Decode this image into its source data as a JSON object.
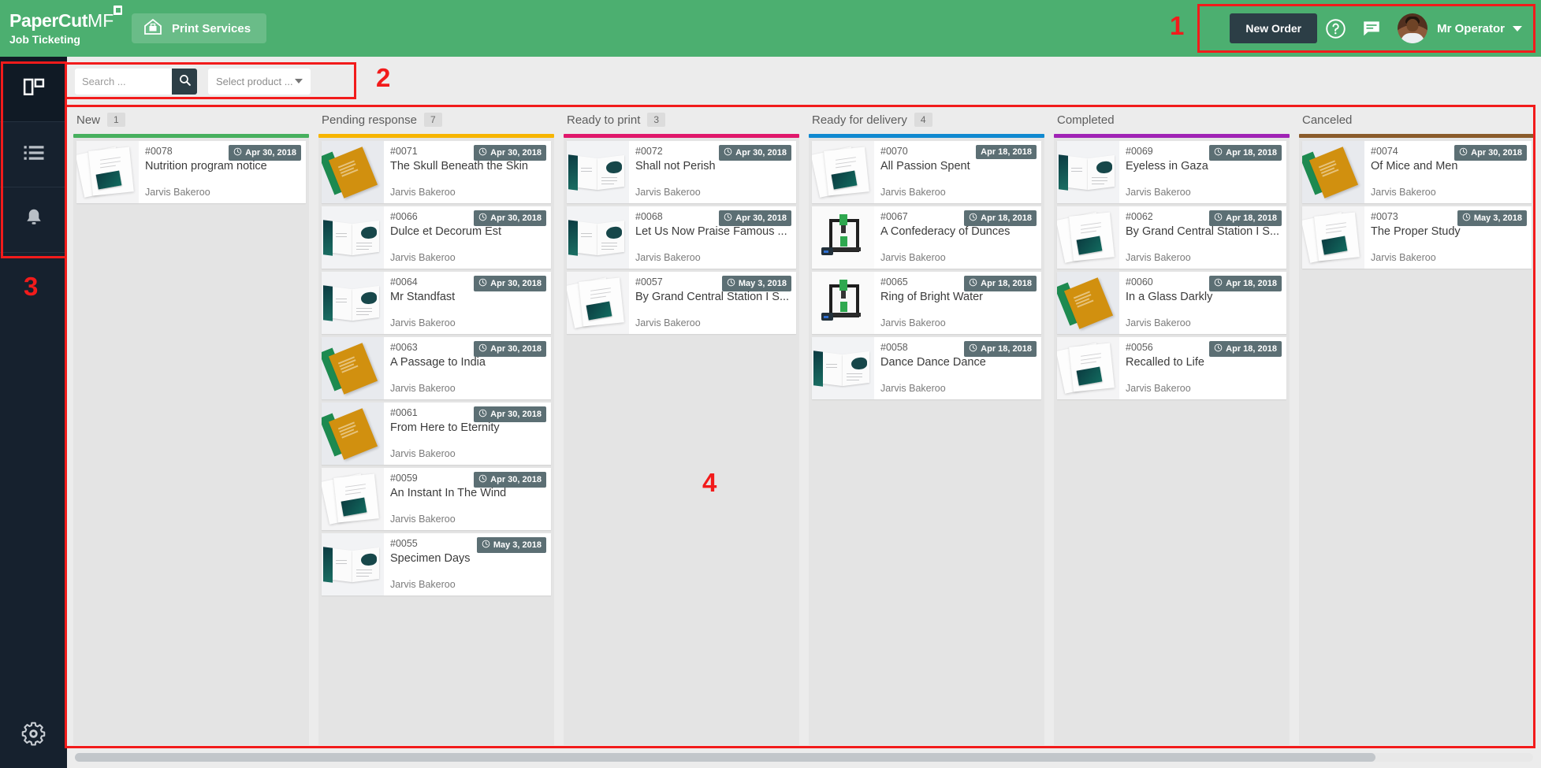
{
  "header": {
    "logo_main": "PaperCut",
    "logo_main_suffix": "MF",
    "logo_sub": "Job Ticketing",
    "print_services_label": "Print Services",
    "new_order_label": "New Order",
    "help_icon": "help-circle-icon",
    "chat_icon": "chat-icon",
    "avatar_icon": "avatar",
    "user_name": "Mr Operator",
    "caret_icon": "chevron-down-icon",
    "bg_color": "#4caf70",
    "button_color": "#2c3e46"
  },
  "sidebar": {
    "items": [
      {
        "name": "dashboard",
        "icon": "board-icon",
        "active": true
      },
      {
        "name": "list",
        "icon": "list-icon",
        "active": false
      },
      {
        "name": "notifications",
        "icon": "bell-icon",
        "active": false
      }
    ],
    "settings_icon": "gear-icon",
    "bg_color": "#16212e"
  },
  "filterbar": {
    "search_value": "",
    "search_placeholder": "Search ...",
    "search_icon": "search-icon",
    "product_select_label": "Select product ...",
    "product_caret_icon": "chevron-down-icon"
  },
  "annotations": [
    {
      "label": "1"
    },
    {
      "label": "2"
    },
    {
      "label": "3"
    },
    {
      "label": "4"
    }
  ],
  "board": {
    "columns": [
      {
        "title": "New",
        "count": "1",
        "accent": "#47b05e",
        "cards": [
          {
            "id": "#0078",
            "title": "Nutrition program notice",
            "owner": "Jarvis Bakeroo",
            "date": "Apr 30, 2018",
            "clock": true,
            "art": "doc"
          }
        ]
      },
      {
        "title": "Pending response",
        "count": "7",
        "accent": "#f7b500",
        "cards": [
          {
            "id": "#0071",
            "title": "The Skull Beneath the Skin",
            "owner": "Jarvis Bakeroo",
            "date": "Apr 30, 2018",
            "clock": true,
            "art": "book"
          },
          {
            "id": "#0066",
            "title": "Dulce et Decorum Est",
            "owner": "Jarvis Bakeroo",
            "date": "Apr 30, 2018",
            "clock": true,
            "art": "mag"
          },
          {
            "id": "#0064",
            "title": "Mr Standfast",
            "owner": "Jarvis Bakeroo",
            "date": "Apr 30, 2018",
            "clock": true,
            "art": "mag"
          },
          {
            "id": "#0063",
            "title": "A Passage to India",
            "owner": "Jarvis Bakeroo",
            "date": "Apr 30, 2018",
            "clock": true,
            "art": "book"
          },
          {
            "id": "#0061",
            "title": "From Here to Eternity",
            "owner": "Jarvis Bakeroo",
            "date": "Apr 30, 2018",
            "clock": true,
            "art": "book"
          },
          {
            "id": "#0059",
            "title": "An Instant In The Wind",
            "owner": "Jarvis Bakeroo",
            "date": "Apr 30, 2018",
            "clock": true,
            "art": "doc"
          },
          {
            "id": "#0055",
            "title": "Specimen Days",
            "owner": "Jarvis Bakeroo",
            "date": "May 3, 2018",
            "clock": true,
            "art": "mag"
          }
        ]
      },
      {
        "title": "Ready to print",
        "count": "3",
        "accent": "#e0176b",
        "cards": [
          {
            "id": "#0072",
            "title": "Shall not Perish",
            "owner": "Jarvis Bakeroo",
            "date": "Apr 30, 2018",
            "clock": true,
            "art": "mag"
          },
          {
            "id": "#0068",
            "title": "Let Us Now Praise Famous ...",
            "owner": "Jarvis Bakeroo",
            "date": "Apr 30, 2018",
            "clock": true,
            "art": "mag"
          },
          {
            "id": "#0057",
            "title": "By Grand Central Station I S...",
            "owner": "Jarvis Bakeroo",
            "date": "May 3, 2018",
            "clock": true,
            "art": "doc"
          }
        ]
      },
      {
        "title": "Ready for delivery",
        "count": "4",
        "accent": "#1089d0",
        "cards": [
          {
            "id": "#0070",
            "title": "All Passion Spent",
            "owner": "Jarvis Bakeroo",
            "date": "Apr 18, 2018",
            "clock": false,
            "art": "doc"
          },
          {
            "id": "#0067",
            "title": "A Confederacy of Dunces",
            "owner": "Jarvis Bakeroo",
            "date": "Apr 18, 2018",
            "clock": true,
            "art": "printer"
          },
          {
            "id": "#0065",
            "title": "Ring of Bright Water",
            "owner": "Jarvis Bakeroo",
            "date": "Apr 18, 2018",
            "clock": true,
            "art": "printer"
          },
          {
            "id": "#0058",
            "title": "Dance Dance Dance",
            "owner": "Jarvis Bakeroo",
            "date": "Apr 18, 2018",
            "clock": true,
            "art": "mag"
          }
        ]
      },
      {
        "title": "Completed",
        "count": "",
        "accent": "#a023b5",
        "cards": [
          {
            "id": "#0069",
            "title": "Eyeless in Gaza",
            "owner": "Jarvis Bakeroo",
            "date": "Apr 18, 2018",
            "clock": true,
            "art": "mag"
          },
          {
            "id": "#0062",
            "title": "By Grand Central Station I S...",
            "owner": "Jarvis Bakeroo",
            "date": "Apr 18, 2018",
            "clock": true,
            "art": "doc"
          },
          {
            "id": "#0060",
            "title": "In a Glass Darkly",
            "owner": "Jarvis Bakeroo",
            "date": "Apr 18, 2018",
            "clock": true,
            "art": "book"
          },
          {
            "id": "#0056",
            "title": "Recalled to Life",
            "owner": "Jarvis Bakeroo",
            "date": "Apr 18, 2018",
            "clock": true,
            "art": "doc"
          }
        ]
      },
      {
        "title": "Canceled",
        "count": "",
        "accent": "#8a5b2b",
        "cards": [
          {
            "id": "#0074",
            "title": "Of Mice and Men",
            "owner": "Jarvis Bakeroo",
            "date": "Apr 30, 2018",
            "clock": true,
            "art": "book"
          },
          {
            "id": "#0073",
            "title": "The Proper Study",
            "owner": "Jarvis Bakeroo",
            "date": "May 3, 2018",
            "clock": true,
            "art": "doc"
          }
        ]
      }
    ]
  }
}
